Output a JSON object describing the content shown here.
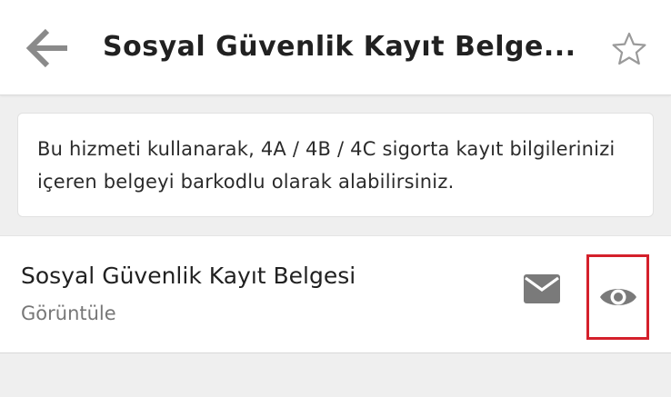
{
  "header": {
    "title": "Sosyal Güvenlik Kayıt Belge...",
    "back_icon": "arrow-back-icon",
    "star_icon": "star-outline-icon"
  },
  "info": {
    "text": "Bu hizmeti kullanarak, 4A / 4B / 4C sigorta kayıt bilgilerinizi içeren belgeyi barkodlu olarak alabilirsiniz."
  },
  "service": {
    "title": "Sosyal Güvenlik Kayıt Belgesi",
    "subtitle": "Görüntüle",
    "mail_icon": "mail-icon",
    "view_icon": "eye-icon"
  },
  "colors": {
    "highlight": "#d4202b",
    "icon_gray": "#7a7a7a",
    "background": "#efefef"
  }
}
